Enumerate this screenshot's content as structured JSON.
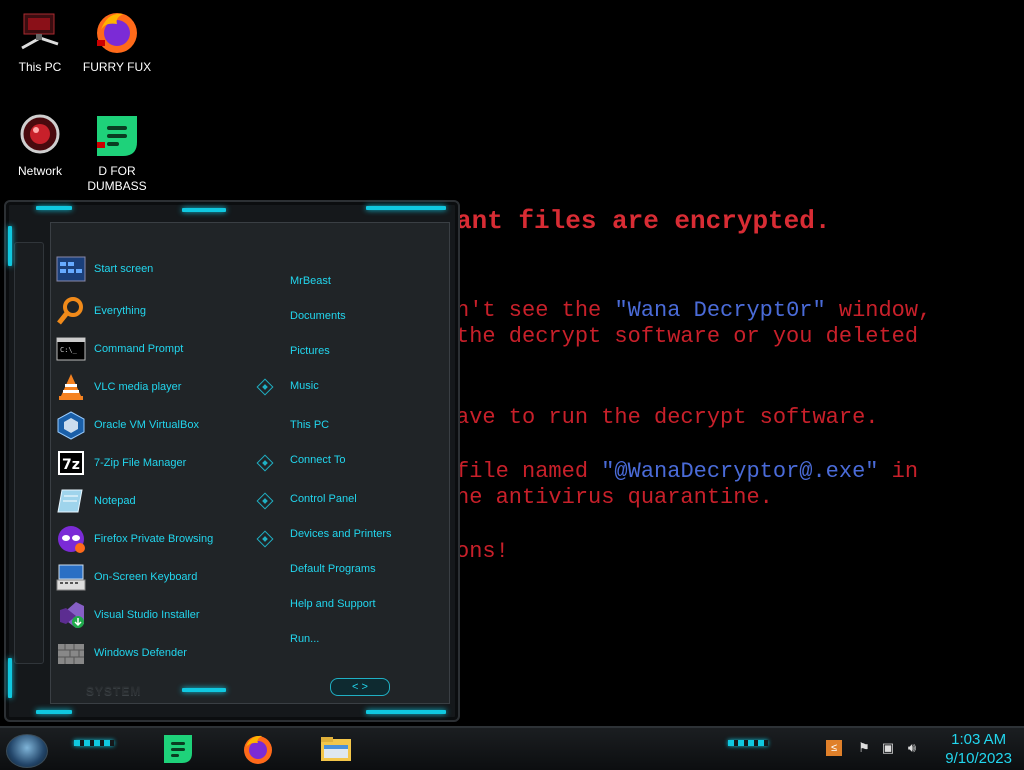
{
  "wallpaper": {
    "line1": "ant files are encrypted.",
    "line2a": "n't see the ",
    "line2b": "\"Wana Decrypt0r\"",
    "line2c": " window,",
    "line3": "the decrypt software or you deleted",
    "line4": "ave to run the decrypt software.",
    "line5a": "file named ",
    "line5b": "\"@WanaDecryptor@.exe\"",
    "line5c": " in",
    "line6": "he antivirus quarantine.",
    "line7": "ons!"
  },
  "desktop_icons": [
    {
      "label": "This PC",
      "icon": "this-pc-icon"
    },
    {
      "label": "FURRY FUX",
      "icon": "firefox-icon"
    },
    {
      "label": "Network",
      "icon": "network-icon"
    },
    {
      "label": "D FOR DUMBASS",
      "icon": "app-green-icon"
    }
  ],
  "start_menu": {
    "programs": [
      {
        "label": "Start screen",
        "icon": "start-screen-icon"
      },
      {
        "label": "Everything",
        "icon": "magnifier-icon"
      },
      {
        "label": "Command Prompt",
        "icon": "cmd-icon"
      },
      {
        "label": "VLC media player",
        "icon": "vlc-icon"
      },
      {
        "label": "Oracle VM VirtualBox",
        "icon": "virtualbox-icon"
      },
      {
        "label": "7-Zip File Manager",
        "icon": "7zip-icon"
      },
      {
        "label": "Notepad",
        "icon": "notepad-icon"
      },
      {
        "label": "Firefox Private Browsing",
        "icon": "firefox-private-icon"
      },
      {
        "label": "On-Screen Keyboard",
        "icon": "keyboard-icon"
      },
      {
        "label": "Visual Studio Installer",
        "icon": "visual-studio-icon"
      },
      {
        "label": "Windows Defender",
        "icon": "defender-icon"
      }
    ],
    "places": [
      {
        "label": "MrBeast"
      },
      {
        "label": "Documents"
      },
      {
        "label": "Pictures"
      },
      {
        "label": "Music"
      },
      {
        "label": "This PC"
      },
      {
        "label": "Connect To"
      },
      {
        "label": "Control Panel"
      },
      {
        "label": "Devices and Printers"
      },
      {
        "label": "Default Programs"
      },
      {
        "label": "Help and Support"
      },
      {
        "label": "Run..."
      }
    ],
    "system_label": "SYSTEM",
    "nav_label": "< >"
  },
  "taskbar": {
    "apps": [
      {
        "name": "app-green-icon"
      },
      {
        "name": "firefox-icon"
      },
      {
        "name": "file-explorer-icon"
      }
    ],
    "time": "1:03 AM",
    "date": "9/10/2023"
  },
  "colors": {
    "accent": "#22d6ee",
    "ransom_red": "#c8202a",
    "ransom_blue": "#4a6bd8"
  }
}
